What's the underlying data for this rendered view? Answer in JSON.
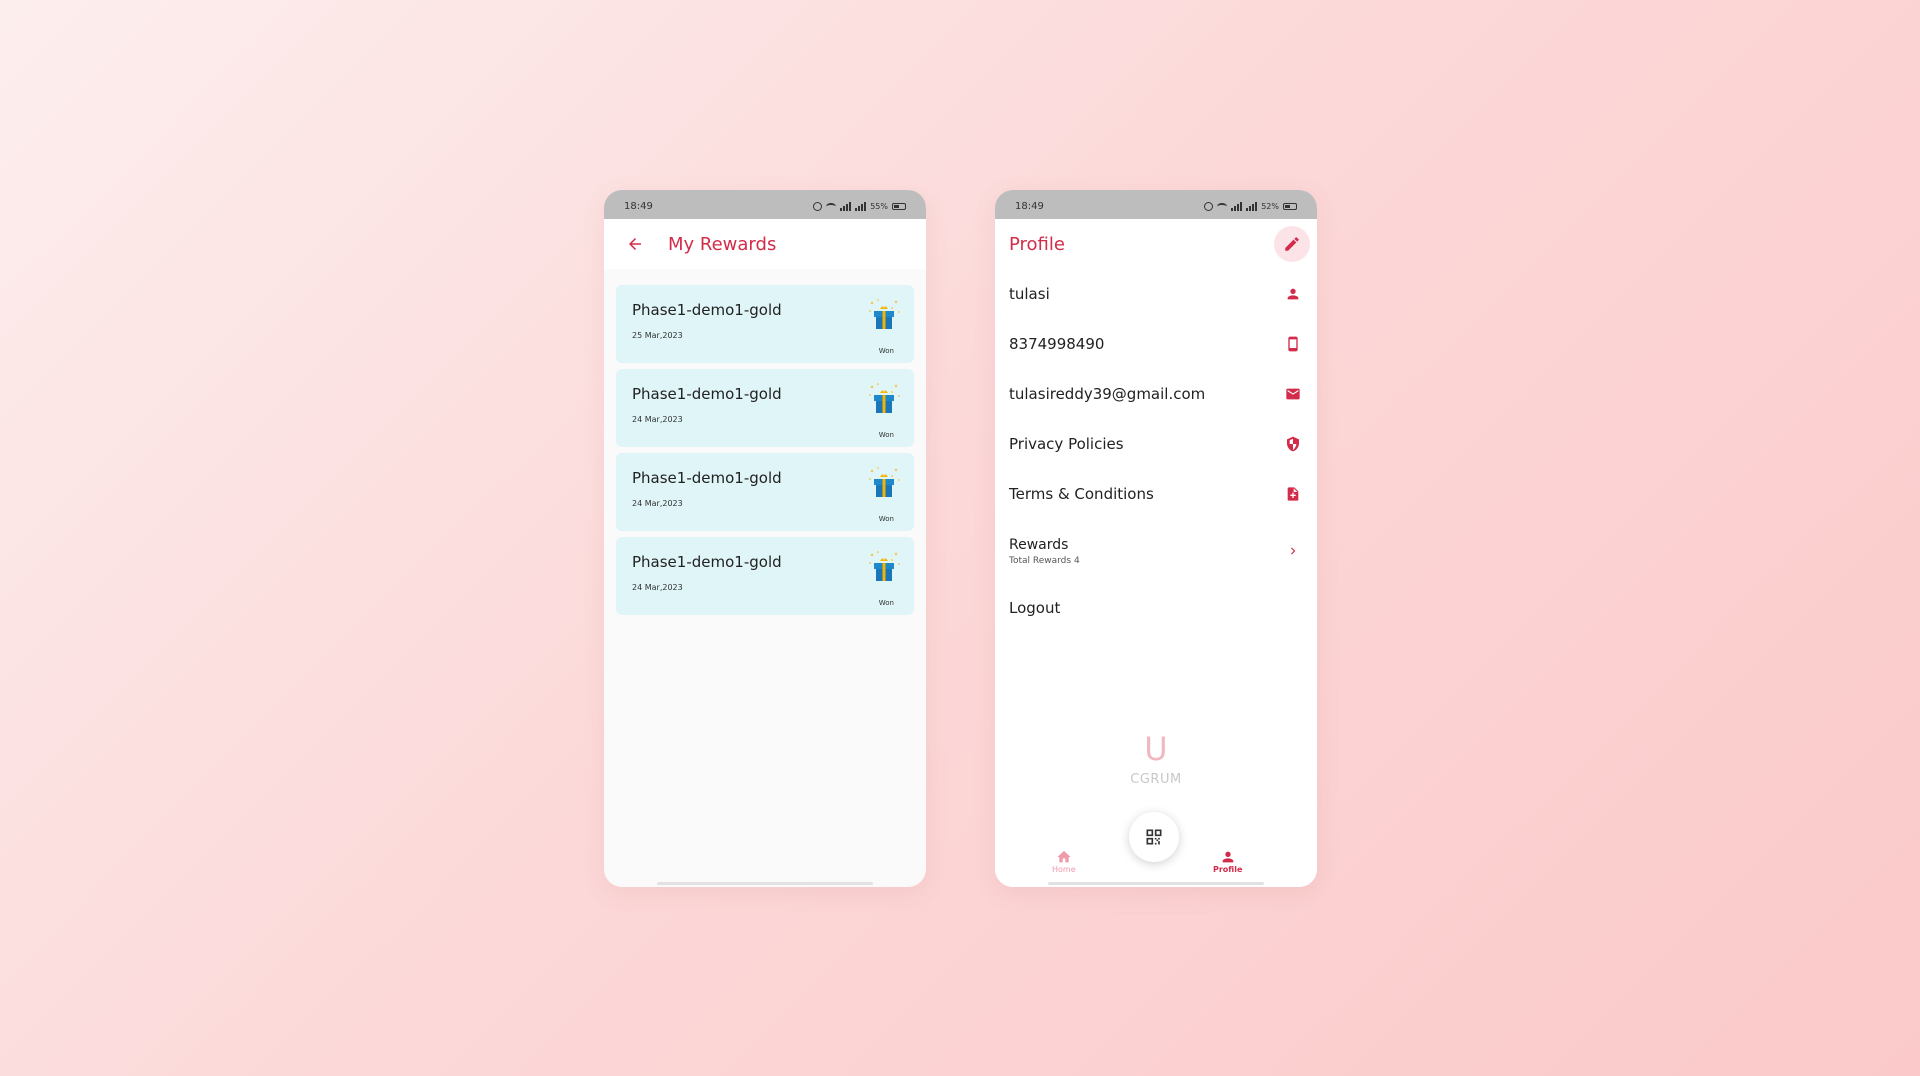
{
  "colors": {
    "accent": "#d22c4a",
    "card_bg": "#dff5f7",
    "status_bar": "#bdbdbd"
  },
  "left_screen": {
    "status": {
      "time": "18:49",
      "battery": "55%"
    },
    "header": {
      "title": "My Rewards",
      "back_icon": "arrow-left-icon"
    },
    "rewards": [
      {
        "title": "Phase1-demo1-gold",
        "date": "25 Mar,2023",
        "status": "Won"
      },
      {
        "title": "Phase1-demo1-gold",
        "date": "24 Mar,2023",
        "status": "Won"
      },
      {
        "title": "Phase1-demo1-gold",
        "date": "24 Mar,2023",
        "status": "Won"
      },
      {
        "title": "Phase1-demo1-gold",
        "date": "24 Mar,2023",
        "status": "Won"
      }
    ]
  },
  "right_screen": {
    "status": {
      "time": "18:49",
      "battery": "52%"
    },
    "header": {
      "title": "Profile",
      "edit_icon": "pencil-icon"
    },
    "profile": {
      "name": "tulasi",
      "phone": "8374998490",
      "email": "tulasireddy39@gmail.com",
      "privacy": "Privacy Policies",
      "terms": "Terms & Conditions",
      "rewards_label": "Rewards",
      "rewards_sub": "Total Rewards 4",
      "logout": "Logout"
    },
    "brand": {
      "logo": "U",
      "name": "CGRUM"
    },
    "nav": {
      "home": "Home",
      "profile": "Profile",
      "scan_icon": "qr-code-icon"
    }
  }
}
